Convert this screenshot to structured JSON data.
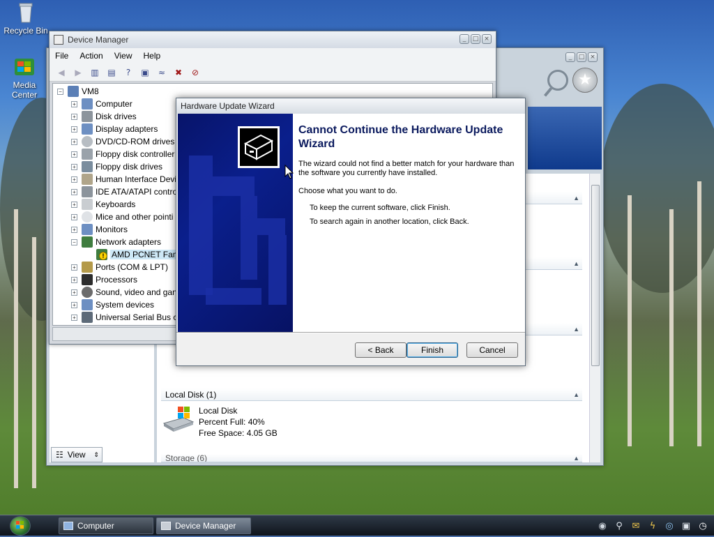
{
  "desktop": {
    "icons": [
      {
        "label": "Recycle Bin"
      },
      {
        "label": "Media Center"
      }
    ]
  },
  "explorer": {
    "groups": [
      {
        "label": "Local Disk (1)"
      },
      {
        "label": "Storage (6)"
      }
    ],
    "disk": {
      "name": "Local Disk",
      "percent_full": "Percent Full: 40%",
      "free_space": "Free Space: 4.05 GB"
    },
    "view_label": "View"
  },
  "device_manager": {
    "title": "Device Manager",
    "menu": [
      "File",
      "Action",
      "View",
      "Help"
    ],
    "root": "VM8",
    "items": [
      {
        "label": "Computer",
        "expanded": false
      },
      {
        "label": "Disk drives",
        "expanded": false
      },
      {
        "label": "Display adapters",
        "expanded": false
      },
      {
        "label": "DVD/CD-ROM drives",
        "expanded": false
      },
      {
        "label": "Floppy disk controller",
        "expanded": false
      },
      {
        "label": "Floppy disk drives",
        "expanded": false
      },
      {
        "label": "Human Interface Devi",
        "expanded": false
      },
      {
        "label": "IDE ATA/ATAPI contro",
        "expanded": false
      },
      {
        "label": "Keyboards",
        "expanded": false
      },
      {
        "label": "Mice and other pointi",
        "expanded": false
      },
      {
        "label": "Monitors",
        "expanded": false
      },
      {
        "label": "Network adapters",
        "expanded": true
      },
      {
        "label": "AMD PCNET Fami",
        "child": true,
        "warning": true
      },
      {
        "label": "Ports (COM & LPT)",
        "expanded": false
      },
      {
        "label": "Processors",
        "expanded": false
      },
      {
        "label": "Sound, video and gan",
        "expanded": false
      },
      {
        "label": "System devices",
        "expanded": false
      },
      {
        "label": "Universal Serial Bus co",
        "expanded": false
      }
    ]
  },
  "wizard": {
    "title": "Hardware Update Wizard",
    "heading": "Cannot Continue the Hardware Update Wizard",
    "message": "The wizard could not find a better match for your hardware than the software you currently have installed.",
    "choose": "Choose what you want to do.",
    "option1": "To keep the current software, click Finish.",
    "option2": "To search again in another location, click Back.",
    "back_label": "< Back",
    "finish_label": "Finish",
    "cancel_label": "Cancel"
  },
  "taskbar": {
    "tasks": [
      {
        "label": "Computer"
      },
      {
        "label": "Device Manager"
      }
    ]
  }
}
